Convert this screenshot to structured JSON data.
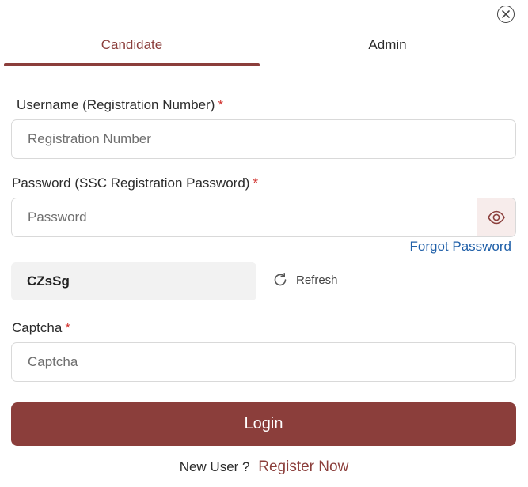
{
  "tabs": [
    {
      "label": "Candidate",
      "active": true
    },
    {
      "label": "Admin",
      "active": false
    }
  ],
  "fields": {
    "username": {
      "label": "Username (Registration Number)",
      "required_mark": "*",
      "placeholder": "Registration Number",
      "value": ""
    },
    "password": {
      "label": "Password (SSC Registration Password)",
      "required_mark": "*",
      "placeholder": "Password",
      "value": ""
    },
    "captcha": {
      "label": "Captcha",
      "required_mark": "*",
      "placeholder": "Captcha",
      "value": ""
    }
  },
  "forgot_password": "Forgot Password",
  "captcha_code": "CZsSg",
  "refresh_label": "Refresh",
  "login_label": "Login",
  "register": {
    "prompt": "New User ?",
    "link": "Register Now"
  },
  "icons": {
    "close": "close-icon",
    "eye": "eye-icon",
    "refresh": "refresh-icon"
  },
  "colors": {
    "accent": "#8b3e3b",
    "link": "#1f5fa8",
    "required": "#d0312d"
  }
}
